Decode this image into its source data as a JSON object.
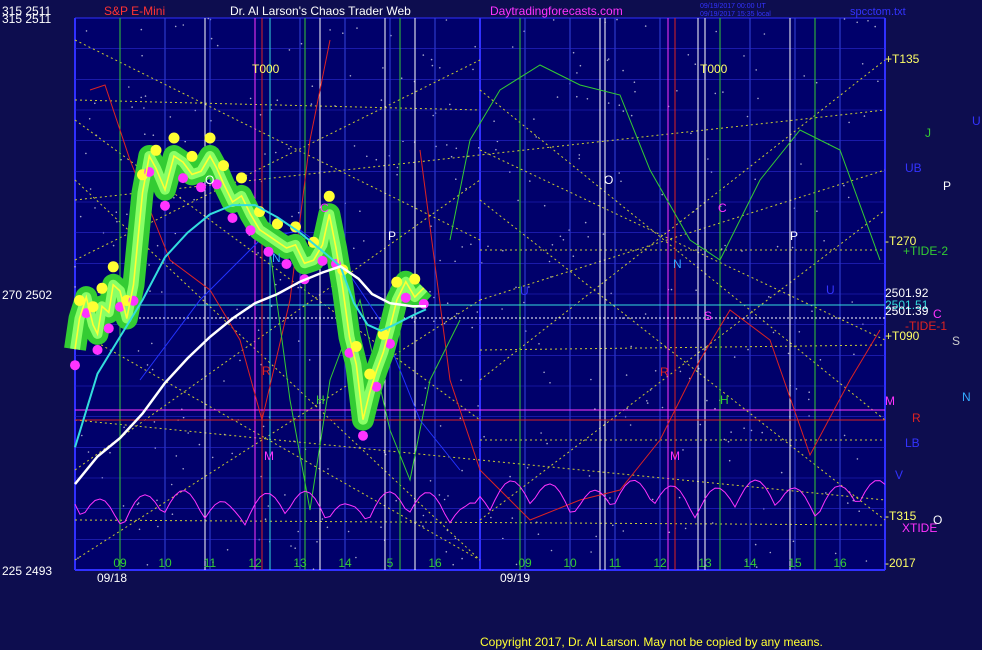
{
  "header": {
    "left_scale": "315  2511",
    "instrument": "S&P E-Mini",
    "title": "Dr. Al Larson's Chaos Trader Web",
    "site": "Daytradingforecasts.com",
    "stamp_line1": "09/19/2017 00:00 UT",
    "stamp_line2": "09/19/2017 15:35 local",
    "file": "spcctom.txt"
  },
  "footer": {
    "copyright": "Copyright 2017, Dr. Al Larson. May not be copied by any means."
  },
  "colors": {
    "background": "#0d0d4f",
    "plot": "#00006b",
    "frame": "#3030ff",
    "price": "#ffff33",
    "bands": "#33cc33",
    "ema_fast": "#33dddd",
    "ema_slow": "#ffffff",
    "magenta": "#ff33ff",
    "red": "#dd2222",
    "green": "#33cc33",
    "gridline": "#cccc33"
  },
  "chart_data": {
    "type": "line",
    "title": "S&P E-Mini",
    "left_axis": {
      "ticks": [
        {
          "label": "315  2511",
          "value": 2511
        },
        {
          "label": "270  2502",
          "value": 2502
        },
        {
          "label": "225  2493",
          "value": 2493
        }
      ],
      "ylim": [
        2493,
        2511
      ]
    },
    "x_ticks": [
      "09",
      "10",
      "11",
      "12",
      "13",
      "14",
      "5",
      "16",
      "09",
      "10",
      "11",
      "12",
      "13",
      "14",
      "15",
      "16"
    ],
    "x_dates": [
      "09/18",
      "09/19"
    ],
    "hour_range": [
      8,
      17
    ],
    "series": [
      {
        "values": [
          [
            8.0,
            2500.2
          ],
          [
            8.1,
            2501.2
          ],
          [
            8.25,
            2501.9
          ],
          [
            8.4,
            2501.0
          ],
          [
            8.5,
            2500.7
          ],
          [
            8.6,
            2501.6
          ],
          [
            8.75,
            2501.4
          ],
          [
            8.85,
            2502.3
          ],
          [
            9.0,
            2502.1
          ],
          [
            9.15,
            2501.2
          ],
          [
            9.3,
            2502.3
          ],
          [
            9.5,
            2505.3
          ],
          [
            9.65,
            2506.5
          ],
          [
            9.8,
            2506.1
          ],
          [
            10.0,
            2505.4
          ],
          [
            10.2,
            2506.5
          ],
          [
            10.4,
            2506.3
          ],
          [
            10.6,
            2505.9
          ],
          [
            10.8,
            2506.0
          ],
          [
            11.0,
            2506.5
          ],
          [
            11.15,
            2506.1
          ],
          [
            11.3,
            2505.6
          ],
          [
            11.5,
            2505.0
          ],
          [
            11.7,
            2505.2
          ],
          [
            11.9,
            2504.6
          ],
          [
            12.1,
            2504.1
          ],
          [
            12.3,
            2503.9
          ],
          [
            12.5,
            2503.7
          ],
          [
            12.7,
            2503.5
          ],
          [
            12.9,
            2503.6
          ],
          [
            13.1,
            2503.0
          ],
          [
            13.3,
            2503.1
          ],
          [
            13.5,
            2503.6
          ],
          [
            13.65,
            2504.6
          ],
          [
            13.8,
            2503.5
          ],
          [
            13.95,
            2502.2
          ],
          [
            14.1,
            2500.6
          ],
          [
            14.25,
            2499.7
          ],
          [
            14.4,
            2497.9
          ],
          [
            14.55,
            2498.8
          ],
          [
            14.7,
            2499.5
          ],
          [
            14.85,
            2500.1
          ],
          [
            15.0,
            2500.9
          ],
          [
            15.15,
            2501.8
          ],
          [
            15.35,
            2502.4
          ],
          [
            15.55,
            2501.9
          ],
          [
            15.75,
            2502.2
          ]
        ]
      },
      {
        "values": [
          [
            8.0,
            2497.0
          ],
          [
            8.5,
            2499.4
          ],
          [
            9.0,
            2500.6
          ],
          [
            9.5,
            2501.8
          ],
          [
            10.0,
            2503.2
          ],
          [
            10.5,
            2504.0
          ],
          [
            11.0,
            2504.6
          ],
          [
            11.5,
            2504.9
          ],
          [
            12.0,
            2504.9
          ],
          [
            12.5,
            2504.5
          ],
          [
            13.0,
            2504.0
          ],
          [
            13.5,
            2503.4
          ],
          [
            13.9,
            2502.9
          ],
          [
            14.2,
            2501.7
          ],
          [
            14.5,
            2501.0
          ],
          [
            14.8,
            2500.8
          ],
          [
            15.1,
            2501.0
          ],
          [
            15.5,
            2501.3
          ],
          [
            15.8,
            2501.5
          ]
        ]
      },
      {
        "values": [
          [
            8.0,
            2495.8
          ],
          [
            8.5,
            2496.7
          ],
          [
            9.0,
            2497.3
          ],
          [
            9.5,
            2498.1
          ],
          [
            10.0,
            2499.1
          ],
          [
            10.5,
            2499.9
          ],
          [
            11.0,
            2500.6
          ],
          [
            11.5,
            2501.2
          ],
          [
            12.0,
            2501.7
          ],
          [
            12.5,
            2502.0
          ],
          [
            13.0,
            2502.4
          ],
          [
            13.5,
            2502.7
          ],
          [
            13.9,
            2502.9
          ],
          [
            14.3,
            2502.5
          ],
          [
            14.6,
            2502.0
          ],
          [
            15.0,
            2501.7
          ],
          [
            15.5,
            2501.6
          ],
          [
            15.8,
            2501.6
          ]
        ]
      }
    ],
    "labels": {
      "price_labels": [
        "2501.92",
        "2501.51",
        "2501.39"
      ],
      "flux_labels_right": [
        "+T135",
        "-T270",
        "+T090",
        "-T315",
        "-2017"
      ],
      "planet_labels_right": [
        {
          "text": "J",
          "color": "#33cc33"
        },
        {
          "text": "U",
          "color": "#3333ff"
        },
        {
          "text": "UB",
          "color": "#3333ff"
        },
        {
          "text": "P",
          "color": "#ffffff"
        },
        {
          "text": "+TIDE-2",
          "color": "#33cc33"
        },
        {
          "text": "C",
          "color": "#ff33ff"
        },
        {
          "text": "-TIDE-1",
          "color": "#dd2222"
        },
        {
          "text": "S",
          "color": "#cccccc"
        },
        {
          "text": "N",
          "color": "#33aaff"
        },
        {
          "text": "M",
          "color": "#ff33ff"
        },
        {
          "text": "R",
          "color": "#dd2222"
        },
        {
          "text": "LB",
          "color": "#3333ff"
        },
        {
          "text": "V",
          "color": "#3333ff"
        },
        {
          "text": "O",
          "color": "#ffffff"
        },
        {
          "text": "XTIDE",
          "color": "#ff33ff"
        }
      ],
      "plot_markers": [
        "T000",
        "O",
        "C",
        "P",
        "N",
        "H",
        "M",
        "U",
        "R",
        "S"
      ]
    }
  }
}
